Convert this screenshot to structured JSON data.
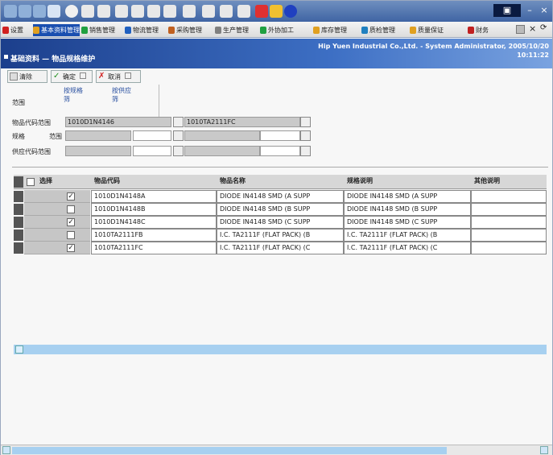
{
  "window": {
    "title_bar_icons": [
      "back-icon",
      "forward-icon",
      "stop-icon",
      "refresh-icon",
      "home-icon",
      "search-icon",
      "favorites-icon",
      "history-icon",
      "mail-icon",
      "print-icon",
      "edit-icon",
      "discuss-icon",
      "messenger-icon",
      "media-icon",
      "warning-icon",
      "help-icon"
    ],
    "controls": [
      "minimize",
      "maximize",
      "close"
    ]
  },
  "tabs": [
    {
      "label": "设置",
      "active": false,
      "color": "#d02020"
    },
    {
      "label": "基本资料管理",
      "active": true,
      "color": "#e0a020"
    },
    {
      "label": "销售管理",
      "active": false,
      "color": "#20a040"
    },
    {
      "label": "物流管理",
      "active": false,
      "color": "#2060c0"
    },
    {
      "label": "采购管理",
      "active": false,
      "color": "#c06020"
    },
    {
      "label": "生产管理",
      "active": false,
      "color": "#808080"
    },
    {
      "label": "外协加工",
      "active": false,
      "color": "#20a040"
    },
    {
      "label": "库存管理",
      "active": false,
      "color": "#e0a020"
    },
    {
      "label": "质检管理",
      "active": false,
      "color": "#2080c0"
    },
    {
      "label": "质量保证",
      "active": false,
      "color": "#e0a020"
    },
    {
      "label": "财务",
      "active": false,
      "color": "#c02020"
    }
  ],
  "tab_icons": [
    "calendar-icon",
    "close-icon",
    "help-icon"
  ],
  "header": {
    "title": "基础资料 — 物品规格维护",
    "company": "Hip Yuen Industrial Co.,Ltd. - System Administrator, 2005/10/20",
    "time": "10:11:22"
  },
  "toolbar": {
    "new_label": "清除",
    "save_label": "确定",
    "delete_label": "取消"
  },
  "filters": {
    "label": "范围",
    "tab1": "按规格\n筛",
    "tab2": "按供应\n筛"
  },
  "criteria": {
    "item_code_label": "物品代码范围",
    "item_code_from": "1010D1N4146",
    "item_code_to": "1010TA2111FC",
    "spec_label": "规格",
    "spec_range_label": "范围",
    "spec_from": "",
    "spec_to": "",
    "supplier_label": "供应代码范围",
    "supplier_from": "",
    "supplier_to": ""
  },
  "grid": {
    "columns": [
      "选择",
      "物品代码",
      "物品名称",
      "规格说明",
      "其他说明"
    ],
    "rows": [
      {
        "checked": true,
        "code": "1010D1N4148A",
        "name": "DIODE IN4148 SMD (A SUPP",
        "spec": "DIODE IN4148 SMD (A SUPP",
        "other": ""
      },
      {
        "checked": false,
        "code": "1010D1N4148B",
        "name": "DIODE IN4148 SMD (B SUPP",
        "spec": "DIODE IN4148 SMD (B SUPP",
        "other": ""
      },
      {
        "checked": true,
        "code": "1010D1N4148C",
        "name": "DIODE IN4148 SMD (C SUPP",
        "spec": "DIODE IN4148 SMD (C SUPP",
        "other": ""
      },
      {
        "checked": false,
        "code": "1010TA2111FB",
        "name": "I.C. TA2111F (FLAT PACK) (B",
        "spec": "I.C. TA2111F (FLAT PACK) (B",
        "other": ""
      },
      {
        "checked": true,
        "code": "1010TA2111FC",
        "name": "I.C. TA2111F (FLAT PACK) (C",
        "spec": "I.C. TA2111F (FLAT PACK) (C",
        "other": ""
      }
    ]
  },
  "colors": {
    "header_blue": "#1c3f8c",
    "active_tab": "#1a4fb0",
    "scroll_blue": "#a7d0f0"
  }
}
